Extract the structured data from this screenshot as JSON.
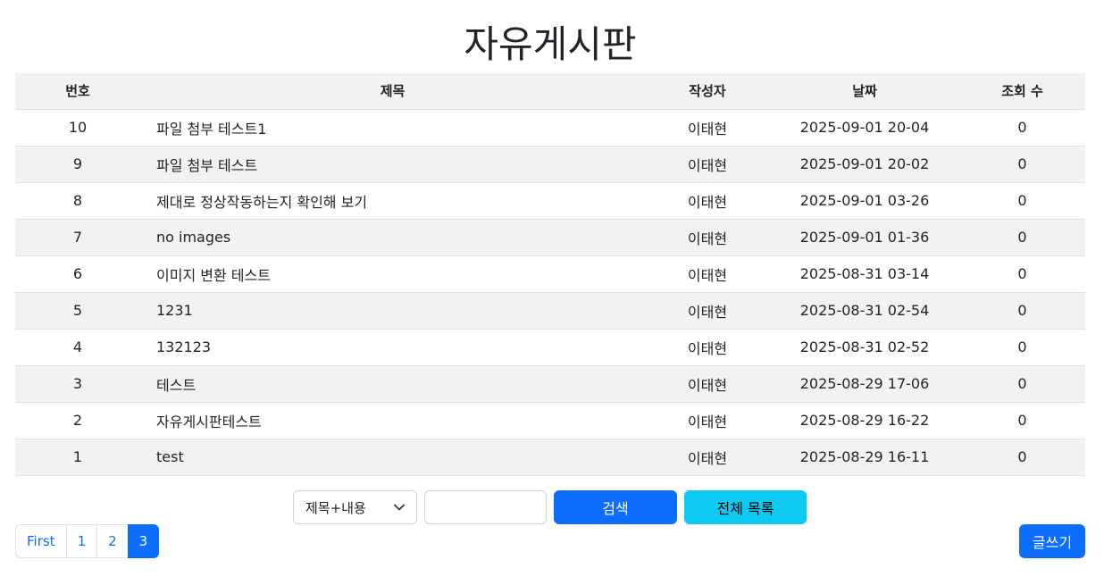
{
  "page": {
    "title": "자유게시판"
  },
  "table": {
    "headers": {
      "num": "번호",
      "title": "제목",
      "author": "작성자",
      "date": "날짜",
      "views": "조회 수"
    },
    "rows": [
      {
        "num": "10",
        "title": "파일 첨부 테스트1",
        "author": "이태현",
        "date": "2025-09-01 20-04",
        "views": "0"
      },
      {
        "num": "9",
        "title": "파일 첨부 테스트",
        "author": "이태현",
        "date": "2025-09-01 20-02",
        "views": "0"
      },
      {
        "num": "8",
        "title": "제대로 정상작동하는지 확인해 보기",
        "author": "이태현",
        "date": "2025-09-01 03-26",
        "views": "0"
      },
      {
        "num": "7",
        "title": "no images",
        "author": "이태현",
        "date": "2025-09-01 01-36",
        "views": "0"
      },
      {
        "num": "6",
        "title": "이미지 변환 테스트",
        "author": "이태현",
        "date": "2025-08-31 03-14",
        "views": "0"
      },
      {
        "num": "5",
        "title": "1231",
        "author": "이태현",
        "date": "2025-08-31 02-54",
        "views": "0"
      },
      {
        "num": "4",
        "title": "132123",
        "author": "이태현",
        "date": "2025-08-31 02-52",
        "views": "0"
      },
      {
        "num": "3",
        "title": "테스트",
        "author": "이태현",
        "date": "2025-08-29 17-06",
        "views": "0"
      },
      {
        "num": "2",
        "title": "자유게시판테스트",
        "author": "이태현",
        "date": "2025-08-29 16-22",
        "views": "0"
      },
      {
        "num": "1",
        "title": "test",
        "author": "이태현",
        "date": "2025-08-29 16-11",
        "views": "0"
      }
    ]
  },
  "search": {
    "select_value": "제목+내용",
    "input_value": "",
    "search_label": "검색",
    "all_label": "전체 목록"
  },
  "pagination": {
    "items": [
      {
        "label": "First",
        "active": false
      },
      {
        "label": "1",
        "active": false
      },
      {
        "label": "2",
        "active": false
      },
      {
        "label": "3",
        "active": true
      }
    ]
  },
  "actions": {
    "write_label": "글쓰기"
  },
  "colors": {
    "primary": "#0d6efd",
    "info": "#0dcaf0",
    "stripe": "#f2f2f2"
  },
  "icons": {
    "select_chevron": "chevron-down-icon"
  }
}
